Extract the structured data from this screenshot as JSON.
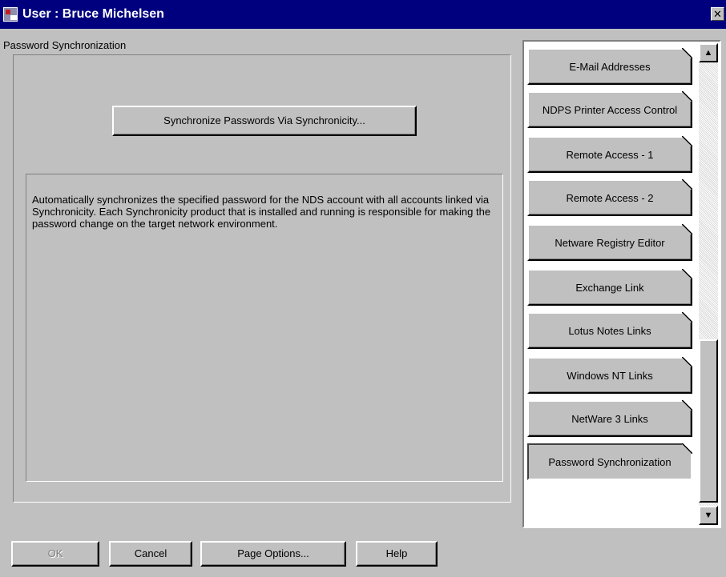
{
  "window": {
    "title": "User : Bruce Michelsen",
    "close_glyph": "✕",
    "icon": "app-icon"
  },
  "group": {
    "label": "Password Synchronization"
  },
  "main": {
    "sync_button_label": "Synchronize Passwords Via Synchronicity...",
    "description": "Automatically synchronizes the specified password for the NDS account with all accounts linked via Synchronicity. Each Synchronicity product that is installed and running is responsible for making the password change on the target network environment."
  },
  "tabs": [
    {
      "label": "E-Mail Addresses",
      "selected": false
    },
    {
      "label": "NDPS Printer Access Control",
      "selected": false
    },
    {
      "label": "Remote Access - 1",
      "selected": false
    },
    {
      "label": "Remote Access - 2",
      "selected": false
    },
    {
      "label": "Netware Registry Editor",
      "selected": false
    },
    {
      "label": "Exchange Link",
      "selected": false
    },
    {
      "label": "Lotus Notes Links",
      "selected": false
    },
    {
      "label": "Windows NT Links",
      "selected": false
    },
    {
      "label": "NetWare 3 Links",
      "selected": false
    },
    {
      "label": "Password Synchronization",
      "selected": true
    }
  ],
  "scrollbar": {
    "up_glyph": "▲",
    "down_glyph": "▼"
  },
  "buttons": {
    "ok": "OK",
    "cancel": "Cancel",
    "page_options": "Page Options...",
    "help": "Help"
  },
  "colors": {
    "titlebar": "#00007f",
    "face": "#c0c0c0"
  }
}
